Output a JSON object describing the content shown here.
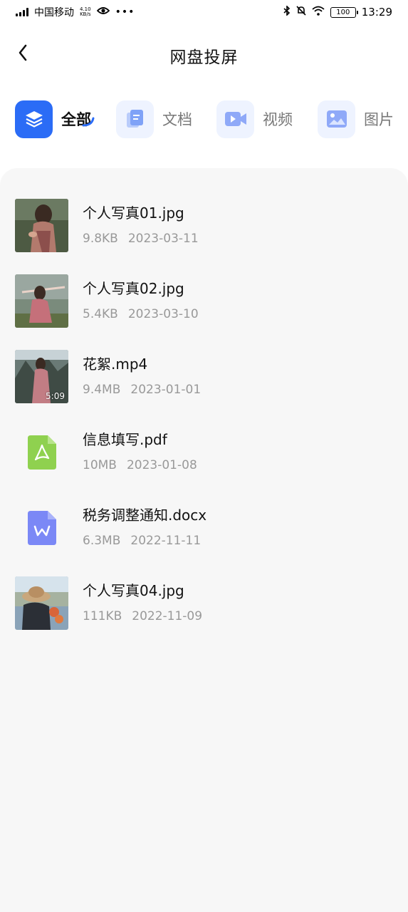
{
  "status_bar": {
    "carrier": "中国移动",
    "net_speed_value": "4.10",
    "net_speed_unit": "KB/s",
    "battery": "100",
    "time": "13:29"
  },
  "header": {
    "title": "网盘投屏"
  },
  "tabs": [
    {
      "label": "全部",
      "icon": "layers-icon",
      "active": true
    },
    {
      "label": "文档",
      "icon": "document-icon",
      "active": false
    },
    {
      "label": "视频",
      "icon": "video-icon",
      "active": false
    },
    {
      "label": "图片",
      "icon": "image-icon",
      "active": false
    }
  ],
  "files": [
    {
      "name": "个人写真01.jpg",
      "size": "9.8KB",
      "date": "2023-03-11",
      "kind": "photo-thumbnail"
    },
    {
      "name": "个人写真02.jpg",
      "size": "5.4KB",
      "date": "2023-03-10",
      "kind": "photo-thumbnail"
    },
    {
      "name": "花絮.mp4",
      "size": "9.4MB",
      "date": "2023-01-01",
      "kind": "video-thumbnail",
      "duration": "5:09"
    },
    {
      "name": "信息填写.pdf",
      "size": "10MB",
      "date": "2023-01-08",
      "kind": "pdf-icon"
    },
    {
      "name": "税务调整通知.docx",
      "size": "6.3MB",
      "date": "2022-11-11",
      "kind": "word-icon"
    },
    {
      "name": "个人写真04.jpg",
      "size": "111KB",
      "date": "2022-11-09",
      "kind": "photo-thumbnail"
    }
  ],
  "colors": {
    "accent": "#2b6cf6",
    "tab_icon_bg": "#eef3ff",
    "panel_bg": "#f7f7f7",
    "pdf_green": "#8fd14f",
    "word_purple": "#7b88f6"
  }
}
